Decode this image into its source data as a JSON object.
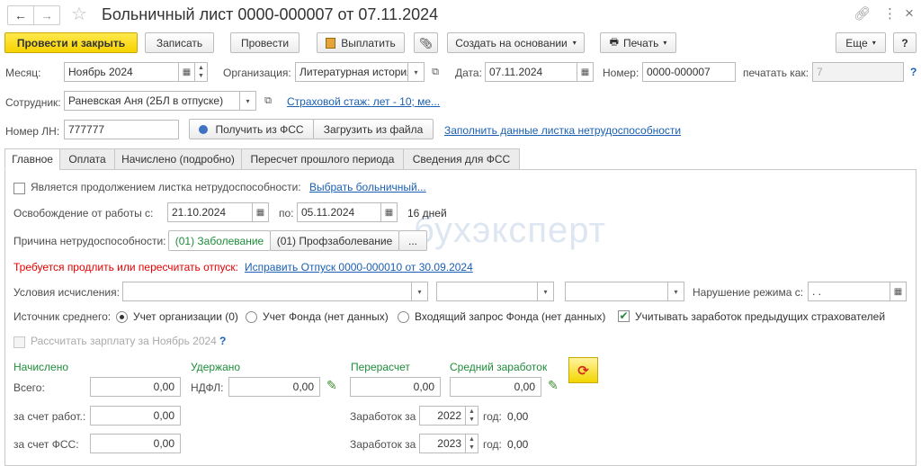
{
  "window": {
    "title": "Больничный лист 0000-000007 от 07.11.2024"
  },
  "toolbar": {
    "post_close": "Провести и закрыть",
    "save": "Записать",
    "post": "Провести",
    "pay": "Выплатить",
    "create_based": "Создать на основании",
    "print": "Печать",
    "more": "Еще",
    "help": "?"
  },
  "header": {
    "month_label": "Месяц:",
    "month_value": "Ноябрь 2024",
    "org_label": "Организация:",
    "org_value": "Литературная история",
    "date_label": "Дата:",
    "date_value": "07.11.2024",
    "number_label": "Номер:",
    "number_value": "0000-000007",
    "print_as_label": "печатать как:",
    "print_as_value": "7",
    "help_q": "?",
    "employee_label": "Сотрудник:",
    "employee_value": "Раневская Аня (2БЛ в отпуске)",
    "insurance_link": "Страховой стаж: лет - 10; ме...",
    "ln_label": "Номер ЛН:",
    "ln_value": "777777",
    "get_fss": "Получить из ФСС",
    "load_file": "Загрузить из файла",
    "fill_link": "Заполнить данные листка нетрудоспособности"
  },
  "tabs": [
    {
      "label": "Главное"
    },
    {
      "label": "Оплата"
    },
    {
      "label": "Начислено (подробно)"
    },
    {
      "label": "Пересчет прошлого периода"
    },
    {
      "label": "Сведения для ФСС"
    }
  ],
  "main": {
    "continuation_label": "Является продолжением листка нетрудоспособности:",
    "choose_sick_link": "Выбрать больничный...",
    "release_label": "Освобождение от работы с:",
    "release_from": "21.10.2024",
    "release_to_label": "по:",
    "release_to": "05.11.2024",
    "days": "16 дней",
    "cause_label": "Причина нетрудоспособности:",
    "cause_opt1": "(01) Заболевание",
    "cause_opt2": "(01) Профзаболевание",
    "cause_more": "...",
    "warning": "Требуется продлить или пересчитать отпуск:",
    "fix_link": "Исправить Отпуск 0000-000010 от 30.09.2024",
    "conditions_label": "Условия исчисления:",
    "violation_label": "Нарушение режима с:",
    "violation_value": " .  .",
    "avg_source_label": "Источник среднего:",
    "avg_opt1": "Учет организации (0)",
    "avg_opt2": "Учет Фонда (нет данных)",
    "avg_opt3": "Входящий запрос Фонда (нет данных)",
    "prev_insurers_label": "Учитывать заработок предыдущих страхователей",
    "calc_salary_label": "Рассчитать зарплату за Ноябрь 2024",
    "calc_help": "?",
    "accrued_header": "Начислено",
    "withheld_header": "Удержано",
    "recalc_header": "Перерасчет",
    "avg_earnings_header": "Средний заработок",
    "total_label": "Всего:",
    "total_value": "0,00",
    "ndfl_label": "НДФЛ:",
    "ndfl_value": "0,00",
    "recalc_value": "0,00",
    "avg_earnings_value": "0,00",
    "employer_label": "за счет работ.:",
    "employer_value": "0,00",
    "fss_label": "за счет ФСС:",
    "fss_value": "0,00",
    "earnings_label1": "Заработок за",
    "earnings_year1": "2022",
    "earnings_year1_label": "год:",
    "earnings_year1_value": "0,00",
    "earnings_label2": "Заработок за",
    "earnings_year2": "2023",
    "earnings_year2_label": "год:",
    "earnings_year2_value": "0,00",
    "watermark": "бухэксперт"
  }
}
